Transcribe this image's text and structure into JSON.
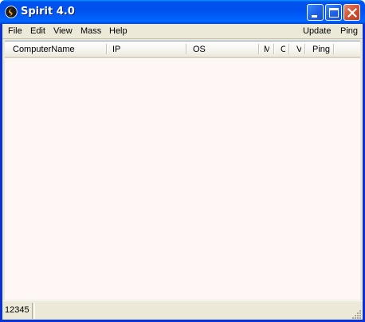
{
  "window": {
    "title": "Spirit 4.0",
    "icon": "spirit-app-icon",
    "controls": [
      "minimize-icon",
      "maximize-icon",
      "close-icon"
    ],
    "title_color": "#ffffff",
    "titlebar_color": "#0050ee"
  },
  "menu": {
    "file": "File",
    "edit": "Edit",
    "view": "View",
    "mass": "Mass",
    "help": "Help",
    "update": "Update",
    "ping": "Ping"
  },
  "list": {
    "columns": {
      "computer_name": "ComputerName",
      "ip": "IP",
      "os": "OS",
      "m": "M",
      "c": "C",
      "v": "V",
      "ping": "Ping"
    },
    "rows": [],
    "background": "#fff6f6"
  },
  "status": {
    "count": "12345"
  }
}
